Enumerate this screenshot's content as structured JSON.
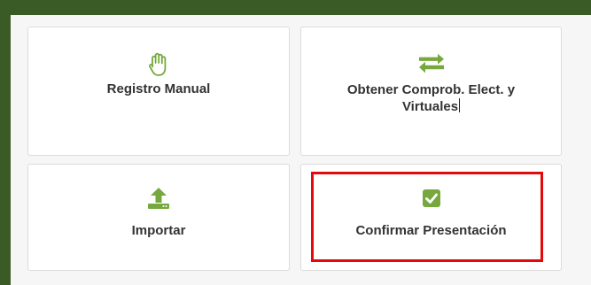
{
  "cards": [
    {
      "label": "Registro Manual",
      "icon": "hand-icon"
    },
    {
      "label_line1": "Obtener Comprob. Elect. y",
      "label_line2": "Virtuales",
      "icon": "exchange-arrows-icon"
    },
    {
      "label": "Importar",
      "icon": "upload-icon"
    },
    {
      "label": "Confirmar Presentación",
      "icon": "checkbox-checked-icon"
    }
  ],
  "colors": {
    "frame": "#3a5a26",
    "icon_green": "#77a83e",
    "highlight_red": "#e3090d",
    "text": "#333333"
  }
}
